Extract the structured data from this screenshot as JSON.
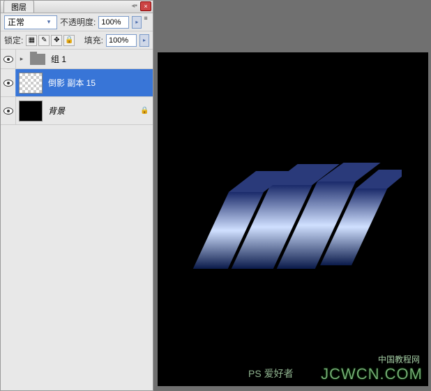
{
  "panel": {
    "tab_label": "图层",
    "close_label": "×",
    "menu_label": "≡"
  },
  "blend": {
    "mode": "正常",
    "opacity_label": "不透明度:",
    "opacity_value": "100%",
    "lock_label": "锁定:",
    "fill_label": "填充:",
    "fill_value": "100%"
  },
  "lock_icons": {
    "transparency": "▦",
    "brush": "✎",
    "move": "✥",
    "all": "🔒"
  },
  "layers": [
    {
      "name": "组 1",
      "type": "group"
    },
    {
      "name": "倒影 副本 15",
      "type": "layer",
      "selected": true,
      "checker": true
    },
    {
      "name": "背景",
      "type": "bg",
      "locked": true,
      "italic": true
    }
  ],
  "watermark": {
    "main": "JCWCN.COM",
    "sub": "中国教程网",
    "logo": "PS 爱好者"
  }
}
